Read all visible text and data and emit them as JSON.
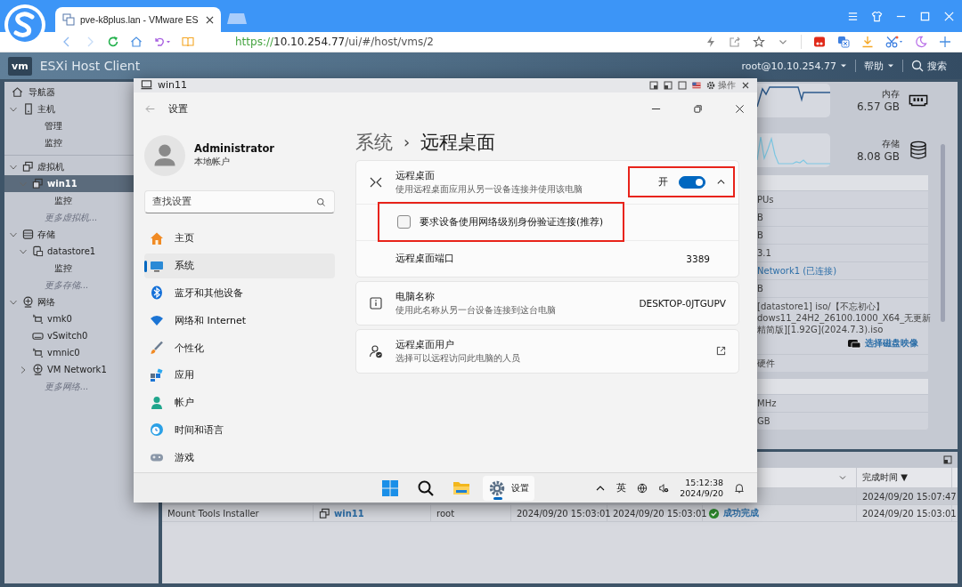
{
  "browser": {
    "tab_title": "pve-k8plus.lan - VMware ES",
    "url_scheme": "https://",
    "url_host": "10.10.254.77",
    "url_path": "/ui/#/host/vms/2"
  },
  "esxi_header": {
    "logo": "vm",
    "title": "ESXi Host Client",
    "user": "root@10.10.254.77",
    "help": "帮助",
    "search": "搜索"
  },
  "navigator": {
    "title": "导航器",
    "items": [
      {
        "label": "主机",
        "kind": "host",
        "selected": false,
        "expanded": true,
        "children": [
          {
            "label": "管理",
            "kind": "page",
            "selected": false
          },
          {
            "label": "监控",
            "kind": "page",
            "selected": false
          }
        ]
      },
      {
        "label": "虚拟机",
        "kind": "vm",
        "selected": false,
        "expanded": true,
        "children": [
          {
            "label": "win11",
            "kind": "vm",
            "selected": true,
            "expanded": true,
            "children": [
              {
                "label": "监控",
                "kind": "page",
                "selected": false
              }
            ]
          },
          {
            "label": "更多虚拟机...",
            "kind": "more",
            "selected": false
          }
        ]
      },
      {
        "label": "存储",
        "kind": "storage",
        "selected": false,
        "expanded": true,
        "children": [
          {
            "label": "datastore1",
            "kind": "datastore",
            "selected": false,
            "expanded": true,
            "children": [
              {
                "label": "监控",
                "kind": "page",
                "selected": false
              }
            ]
          },
          {
            "label": "更多存储...",
            "kind": "more",
            "selected": false
          }
        ]
      },
      {
        "label": "网络",
        "kind": "network",
        "selected": false,
        "expanded": true,
        "children": [
          {
            "label": "vmk0",
            "kind": "vmk",
            "selected": false
          },
          {
            "label": "vSwitch0",
            "kind": "switch",
            "selected": false
          },
          {
            "label": "vmnic0",
            "kind": "nic",
            "selected": false
          },
          {
            "label": "VM Network1",
            "kind": "portgroup",
            "selected": false,
            "expanded": false
          },
          {
            "label": "更多网络...",
            "kind": "more",
            "selected": false
          }
        ]
      }
    ]
  },
  "summary": {
    "stats": [
      {
        "kind": "memory",
        "label": "内存",
        "value": "6.57 GB"
      },
      {
        "kind": "storage",
        "label": "存储",
        "value": "8.08 GB"
      }
    ],
    "hardware_rows": [
      {
        "kind": "text",
        "text": "PUs"
      },
      {
        "kind": "text",
        "text": "B"
      },
      {
        "kind": "text",
        "text": "B"
      },
      {
        "kind": "text",
        "text": "3.1"
      },
      {
        "kind": "link",
        "text": "Network1 (已连接)"
      },
      {
        "kind": "text",
        "text": "B"
      },
      {
        "kind": "media",
        "lines": [
          "[datastore1] iso/【不忘初心】",
          "dows11_24H2_26100.1000_X64_无更新",
          "精简版][1.92G](2024.7.3).iso"
        ],
        "action": "选择磁盘映像"
      },
      {
        "kind": "text",
        "text": "硬件"
      }
    ],
    "resource_rows": [
      "MHz",
      "GB"
    ]
  },
  "tasks": {
    "columns": [
      {
        "label": "完成时间",
        "sort": "▼"
      }
    ],
    "rows": [
      {
        "completed": "2024/09/20 15:07:47"
      },
      {
        "column_1": "Mount Tools Installer",
        "column_2": "win11",
        "column_3": "root",
        "column_4": "2024/09/20 15:03:01",
        "column_5": "2024/09/20 15:03:01",
        "result": {
          "text": "成功完成"
        },
        "completed": "2024/09/20 15:03:01"
      }
    ]
  },
  "vm_console": {
    "title": "win11",
    "actions": "操作",
    "settings": {
      "app_title": "设置",
      "user": {
        "name": "Administrator",
        "account_type": "本地帐户"
      },
      "search_placeholder": "查找设置",
      "nav": [
        {
          "label": "主页",
          "kind": "home",
          "selected": false
        },
        {
          "label": "系统",
          "kind": "system",
          "selected": true
        },
        {
          "label": "蓝牙和其他设备",
          "kind": "bluetooth",
          "selected": false
        },
        {
          "label": "网络和 Internet",
          "kind": "network",
          "selected": false
        },
        {
          "label": "个性化",
          "kind": "personalize",
          "selected": false
        },
        {
          "label": "应用",
          "kind": "apps",
          "selected": false
        },
        {
          "label": "帐户",
          "kind": "account",
          "selected": false
        },
        {
          "label": "时间和语言",
          "kind": "time",
          "selected": false
        },
        {
          "label": "游戏",
          "kind": "gaming",
          "selected": false
        }
      ],
      "breadcrumb": {
        "parent": "系统",
        "separator": "›",
        "current": "远程桌面"
      },
      "cards": [
        {
          "kind": "toggle",
          "title": "远程桌面",
          "description": "使用远程桌面应用从另一设备连接并使用该电脑",
          "state_label": "开",
          "on": true,
          "expanded": true,
          "highlighted": true,
          "options": [
            {
              "kind": "checkbox",
              "label": "要求设备使用网络级别身份验证连接(推荐)",
              "checked": false,
              "highlighted": true
            },
            {
              "kind": "value",
              "label": "远程桌面端口",
              "value": "3389"
            }
          ]
        },
        {
          "kind": "value",
          "title": "电脑名称",
          "description": "使用此名称从另一台设备连接到这台电脑",
          "value": "DESKTOP-0JTGUPV"
        },
        {
          "kind": "link",
          "title": "远程桌面用户",
          "description": "选择可以远程访问此电脑的人员"
        }
      ]
    },
    "taskbar": {
      "apps": [
        {
          "kind": "start",
          "selected": false
        },
        {
          "kind": "search",
          "selected": false
        },
        {
          "kind": "explorer",
          "selected": false
        },
        {
          "kind": "settings",
          "label": "设置",
          "selected": true
        }
      ],
      "ime": "英",
      "time": "15:12:38",
      "date": "2024/9/20"
    }
  }
}
